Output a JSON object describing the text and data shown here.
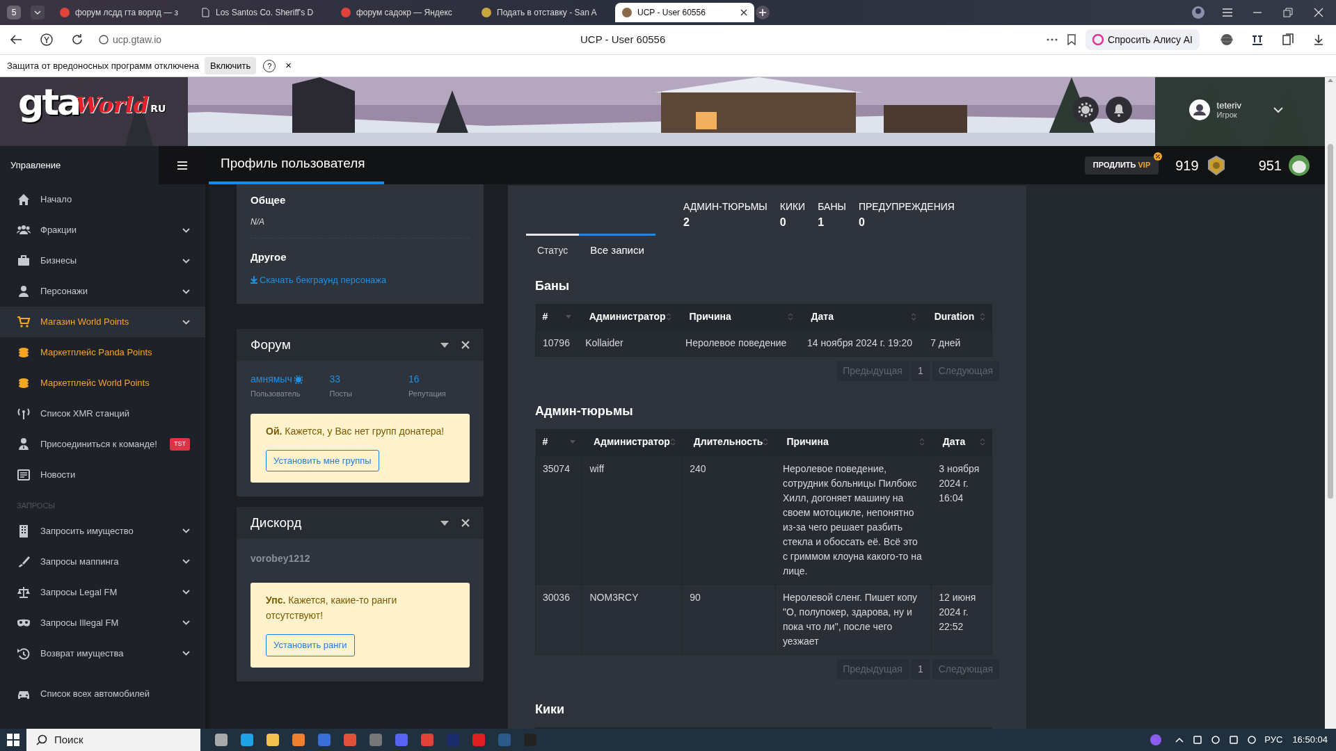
{
  "browser": {
    "tab_count": "5",
    "tabs": [
      {
        "title": "форум лсдд гта ворлд — з",
        "selected": false
      },
      {
        "title": "Los Santos Co. Sheriff's D",
        "selected": false
      },
      {
        "title": "форум садокр — Яндекс",
        "selected": false
      },
      {
        "title": "Подать в отставку - San A",
        "selected": false
      },
      {
        "title": "UCP - User 60556",
        "selected": true
      }
    ],
    "address": "ucp.gtaw.io",
    "page_title": "UCP - User 60556",
    "assistant": "Спросить Алису AI"
  },
  "infobar": {
    "message": "Защита от вредоносных программ отключена",
    "button": "Включить",
    "help": "?",
    "close": "×"
  },
  "header": {
    "logo": [
      "gta",
      "World",
      "RU"
    ],
    "user": {
      "name": "teteriv",
      "role": "Игрок"
    }
  },
  "topbar": {
    "menu_title": "Управление",
    "page_title": "Профиль пользователя",
    "vip": {
      "label": "ПРОДЛИТЬ",
      "highlight": "VIP"
    },
    "points": [
      "919",
      "951"
    ]
  },
  "sidebar": {
    "items": [
      {
        "kind": "item",
        "label": "Начало",
        "expandable": false,
        "selected": false,
        "highlighted": false
      },
      {
        "kind": "item",
        "label": "Фракции",
        "expandable": true,
        "selected": false,
        "highlighted": false
      },
      {
        "kind": "item",
        "label": "Бизнесы",
        "expandable": true,
        "selected": false,
        "highlighted": false
      },
      {
        "kind": "item",
        "label": "Персонажи",
        "expandable": true,
        "selected": false,
        "highlighted": false
      },
      {
        "kind": "item",
        "label": "Магазин World Points",
        "expandable": true,
        "selected": true,
        "highlighted": true
      },
      {
        "kind": "item",
        "label": "Маркетплейс Panda Points",
        "expandable": false,
        "selected": false,
        "highlighted": true
      },
      {
        "kind": "item",
        "label": "Маркетплейс World Points",
        "expandable": false,
        "selected": false,
        "highlighted": true
      },
      {
        "kind": "item",
        "label": "Список XMR станций",
        "expandable": false,
        "selected": false,
        "highlighted": false
      },
      {
        "kind": "item",
        "label": "Присоединиться к команде!",
        "badge": "TST",
        "expandable": false,
        "selected": false,
        "highlighted": false
      },
      {
        "kind": "item",
        "label": "Новости",
        "expandable": false,
        "selected": false,
        "highlighted": false
      },
      {
        "kind": "heading",
        "label": "ЗАПРОСЫ"
      },
      {
        "kind": "item",
        "label": "Запросить имущество",
        "expandable": true,
        "selected": false,
        "highlighted": false
      },
      {
        "kind": "item",
        "label": "Запросы маппинга",
        "expandable": true,
        "selected": false,
        "highlighted": false
      },
      {
        "kind": "item",
        "label": "Запросы Legal FM",
        "expandable": true,
        "selected": false,
        "highlighted": false
      },
      {
        "kind": "item",
        "label": "Запросы Illegal FM",
        "expandable": true,
        "selected": false,
        "highlighted": false
      },
      {
        "kind": "item",
        "label": "Возврат имущества",
        "expandable": true,
        "selected": false,
        "highlighted": false
      },
      {
        "kind": "gap"
      },
      {
        "kind": "item",
        "label": "Список всех автомобилей",
        "expandable": false,
        "selected": false,
        "highlighted": false
      }
    ]
  },
  "info_card": {
    "sections": [
      {
        "title": "Общее",
        "kind": "text",
        "value": "N/A"
      },
      {
        "title": "Другое",
        "kind": "link",
        "value": "Скачать бекграунд персонажа"
      }
    ]
  },
  "forum_card": {
    "title": "Форум",
    "stats": [
      {
        "value": "амнямыч",
        "label": "Пользователь",
        "verified": true
      },
      {
        "value": "33",
        "label": "Посты",
        "verified": false
      },
      {
        "value": "16",
        "label": "Репутация",
        "verified": false
      }
    ],
    "alert": "**Ой.** Кажется, у Вас нет групп донатера!",
    "button": "Установить мне группы"
  },
  "discord_card": {
    "title": "Дискорд",
    "username": "vorobey1212",
    "alert": "**Упс.** Кажется, какие-то ранги отсутствуют!",
    "button": "Установить ранги"
  },
  "counters": [
    {
      "label": "АДМИН-ТЮРЬМЫ",
      "value": "2"
    },
    {
      "label": "КИКИ",
      "value": "0"
    },
    {
      "label": "БАНЫ",
      "value": "1"
    },
    {
      "label": "ПРЕДУПРЕЖДЕНИЯ",
      "value": "0"
    }
  ],
  "tabs": [
    {
      "label": "Статус",
      "selected": false
    },
    {
      "label": "Все записи",
      "selected": true
    }
  ],
  "sections": [
    {
      "title": "Баны",
      "columns": [
        {
          "label": "#",
          "sorted": true
        },
        {
          "label": "Администратор",
          "sorted": false
        },
        {
          "label": "Причина",
          "sorted": false
        },
        {
          "label": "Дата",
          "sorted": false
        },
        {
          "label": "Duration",
          "sorted": false
        }
      ],
      "rows": [
        [
          "10796",
          "Kollaider",
          "Неролевое поведение",
          "14 ноября 2024 г. 19:20",
          "7 дней"
        ]
      ],
      "pagination": {
        "prev": "Предыдущая",
        "page": "1",
        "next": "Следующая",
        "disabled": true
      }
    },
    {
      "title": "Админ-тюрьмы",
      "columns": [
        {
          "label": "#",
          "sorted": true
        },
        {
          "label": "Администратор",
          "sorted": false
        },
        {
          "label": "Длительность",
          "sorted": false
        },
        {
          "label": "Причина",
          "sorted": false
        },
        {
          "label": "Дата",
          "sorted": false
        }
      ],
      "rows": [
        [
          "35074",
          "wiff",
          "240",
          "Неролевое поведение, сотрудник больницы Пилбокс Хилл, догоняет машину на своем мотоцикле, непонятно из-за чего решает разбить стекла и обоссать её. Всё это с гриммом клоуна какого-то на лице.",
          "3 ноября 2024 г. 16:04"
        ],
        [
          "30036",
          "NOM3RCY",
          "90",
          "Неролевой сленг. Пишет копу \"О, полупокер, здарова, ну и пока что ли\", после чего уезжает",
          "12 июня 2024 г. 22:52"
        ]
      ],
      "pagination": {
        "prev": "Предыдущая",
        "page": "1",
        "next": "Следующая",
        "disabled": true
      }
    },
    {
      "title": "Кики"
    }
  ],
  "taskbar": {
    "search": "Поиск",
    "language": "РУС",
    "time": "16:50:04"
  }
}
